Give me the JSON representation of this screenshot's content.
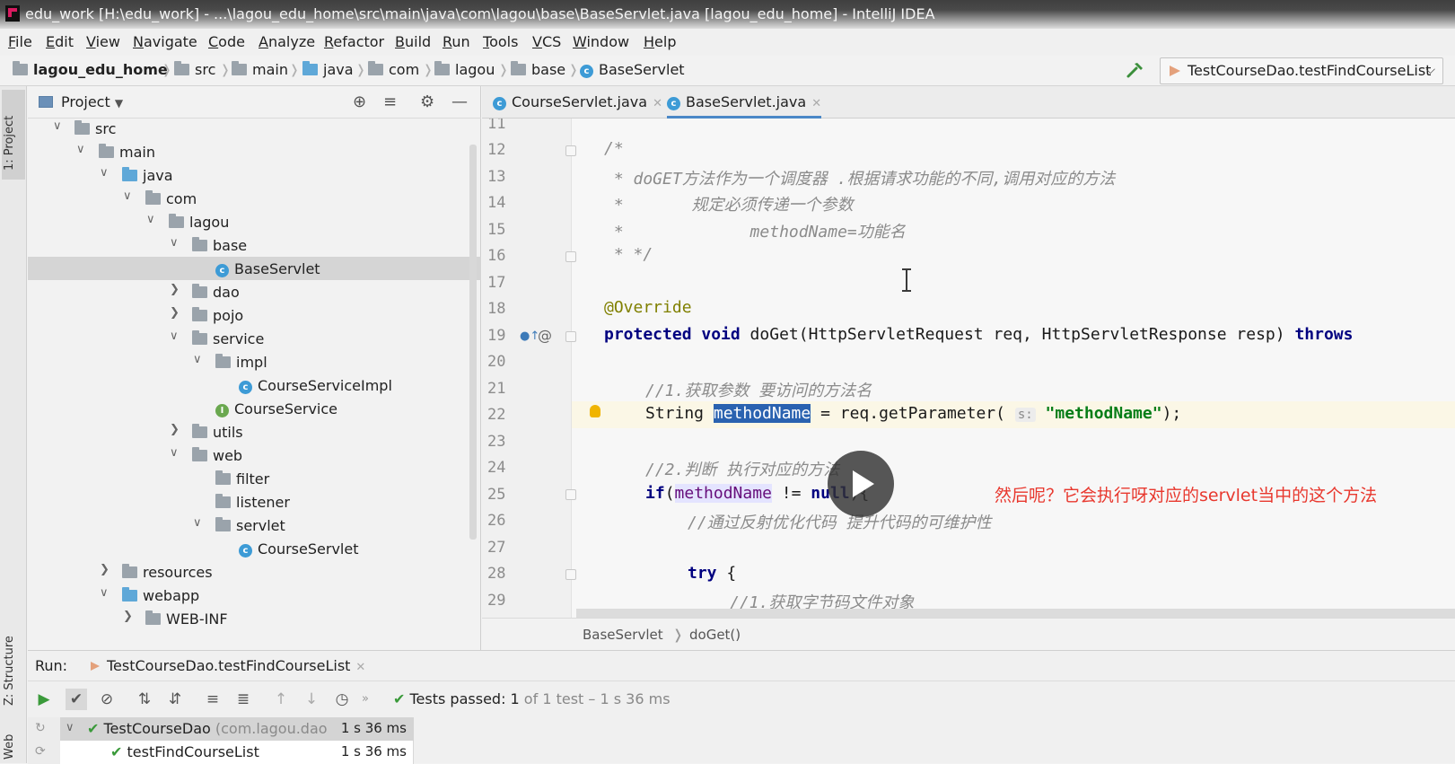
{
  "window": {
    "title": "edu_work [H:\\edu_work] - ...\\lagou_edu_home\\src\\main\\java\\com\\lagou\\base\\BaseServlet.java [lagou_edu_home] - IntelliJ IDEA"
  },
  "menu": [
    "File",
    "Edit",
    "View",
    "Navigate",
    "Code",
    "Analyze",
    "Refactor",
    "Build",
    "Run",
    "Tools",
    "VCS",
    "Window",
    "Help"
  ],
  "breadcrumb": [
    "lagou_edu_home",
    "src",
    "main",
    "java",
    "com",
    "lagou",
    "base",
    "BaseServlet"
  ],
  "run_config": "TestCourseDao.testFindCourseList",
  "left_strip": {
    "project": "1: Project",
    "structure": "Z: Structure",
    "web": "Web"
  },
  "project_panel": {
    "title": "Project",
    "tree": [
      {
        "label": "src"
      },
      {
        "label": "main"
      },
      {
        "label": "java"
      },
      {
        "label": "com"
      },
      {
        "label": "lagou"
      },
      {
        "label": "base"
      },
      {
        "label": "BaseServlet"
      },
      {
        "label": "dao"
      },
      {
        "label": "pojo"
      },
      {
        "label": "service"
      },
      {
        "label": "impl"
      },
      {
        "label": "CourseServiceImpl"
      },
      {
        "label": "CourseService"
      },
      {
        "label": "utils"
      },
      {
        "label": "web"
      },
      {
        "label": "filter"
      },
      {
        "label": "listener"
      },
      {
        "label": "servlet"
      },
      {
        "label": "CourseServlet"
      },
      {
        "label": "resources"
      },
      {
        "label": "webapp"
      },
      {
        "label": "WEB-INF"
      }
    ]
  },
  "editor": {
    "tabs": [
      {
        "label": "CourseServlet.java"
      },
      {
        "label": "BaseServlet.java"
      }
    ],
    "line_numbers": [
      "11",
      "12",
      "13",
      "14",
      "15",
      "16",
      "17",
      "18",
      "19",
      "20",
      "21",
      "22",
      "23",
      "24",
      "25",
      "26",
      "27",
      "28",
      "29"
    ],
    "lines": {
      "l12": "/*",
      "l13": " * doGET方法作为一个调度器 .根据请求功能的不同,调用对应的方法",
      "l14": " *       规定必须传递一个参数",
      "l15": " *             methodName=功能名",
      "l16": " * */",
      "l18": "@Override",
      "l19_kw": "protected void",
      "l19_rest": " doGet(HttpServletRequest req, HttpServletResponse resp) ",
      "l19_throws": "throws",
      "l21": "//1.获取参数 要访问的方法名",
      "l22_type": "String ",
      "l22_var": "methodName",
      "l22_mid": " = req.getParameter( ",
      "l22_hint": "s:",
      "l22_str": "\"methodName\"",
      "l22_end": ");",
      "l24": "//2.判断 执行对应的方法",
      "l25_kw": "if",
      "l25_open": "(",
      "l25_var": "methodName",
      "l25_mid": " != ",
      "l25_null": "null",
      "l25_end": "){",
      "l26": "//通过反射优化代码 提升代码的可维护性",
      "l28_kw": "try",
      "l28_end": " {",
      "l29": "//1.获取字节码文件对象"
    },
    "crumbs": [
      "BaseServlet",
      "doGet()"
    ]
  },
  "overlay": {
    "subtitle": "然后呢？它会执行呀对应的servlet当中的这个方法"
  },
  "run_panel": {
    "label": "Run:",
    "tab": "TestCourseDao.testFindCourseList",
    "status_main": "Tests passed: 1",
    "status_rest": " of 1 test – 1 s 36 ms",
    "tree": [
      {
        "name": "TestCourseDao",
        "pkg": " (com.lagou.dao",
        "time": "1 s 36 ms"
      },
      {
        "name": "testFindCourseList",
        "pkg": "",
        "time": "1 s 36 ms"
      }
    ]
  },
  "colors": {
    "keyword": "#000080",
    "annotation": "#808000",
    "string": "#067d17",
    "comment": "#8b8b8b",
    "selection": "#2a62b0",
    "subtitle": "#e8382e",
    "pass": "#3a9a3a"
  }
}
